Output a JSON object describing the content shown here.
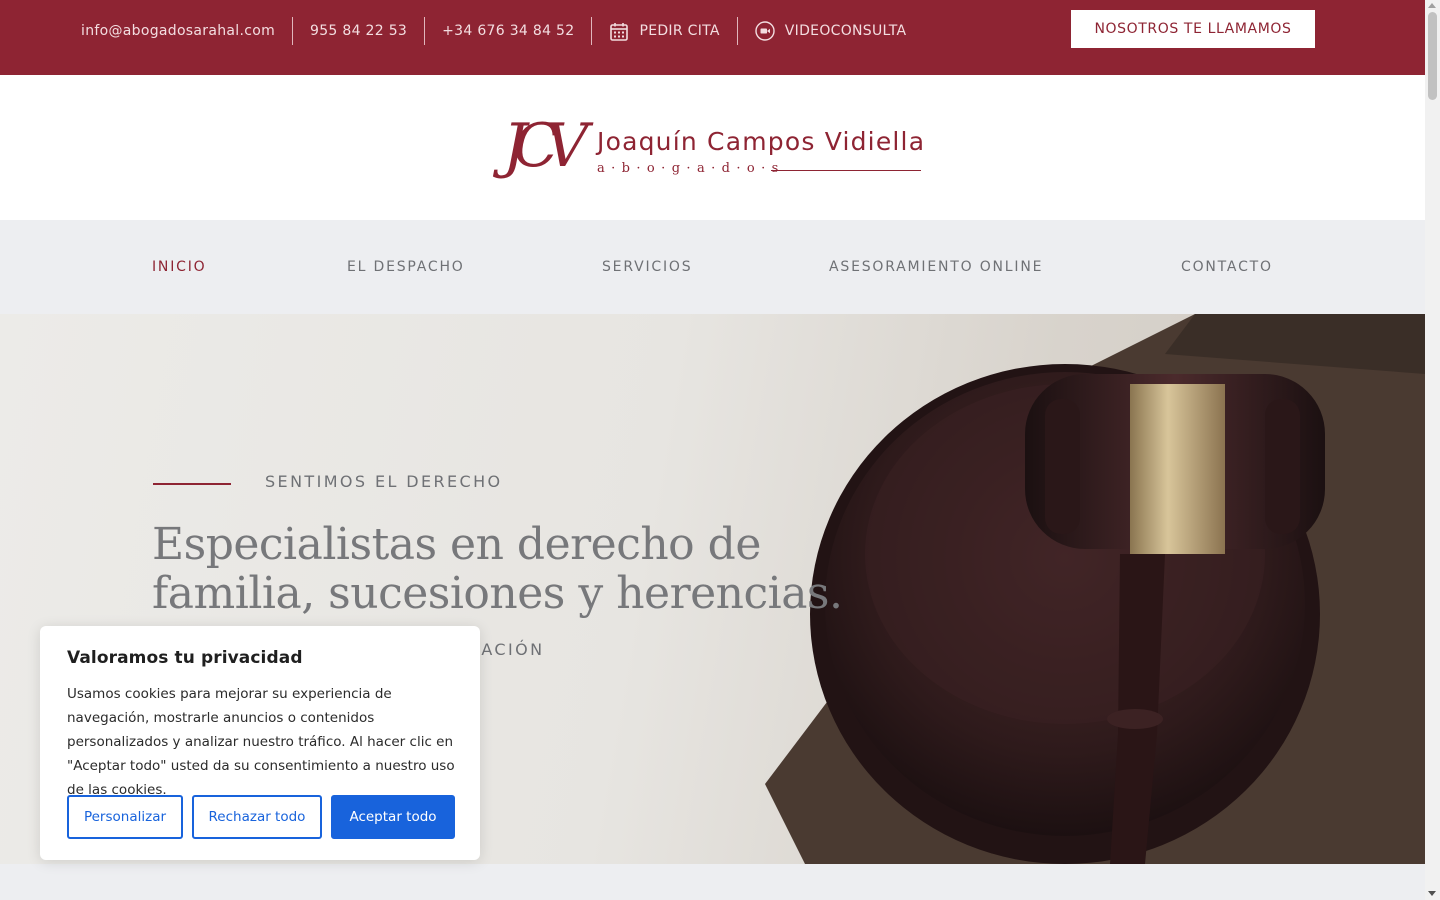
{
  "topbar": {
    "email": "info@abogadosarahal.com",
    "phone1": "955 84 22 53",
    "phone2": "+34 676 34 84 52",
    "appointment": "PEDIR CITA",
    "video": "VIDEOCONSULTA",
    "call_button": "NOSOTROS TE LLAMAMOS"
  },
  "logo": {
    "monogram": "JCV",
    "name": "Joaquín Campos Vidiella",
    "subtitle": "a·b·o·g·a·d·o·s"
  },
  "nav": {
    "items": [
      "INICIO",
      "EL DESPACHO",
      "SERVICIOS",
      "ASESORAMIENTO ONLINE",
      "CONTACTO"
    ],
    "active": "INICIO"
  },
  "hero": {
    "kicker": "SENTIMOS EL DERECHO",
    "headline": "Especialistas en derecho de familia, sucesiones y herencias.",
    "tagline_visible": "DICACIÓN"
  },
  "cookie": {
    "title": "Valoramos tu privacidad",
    "text": "Usamos cookies para mejorar su experiencia de navegación, mostrarle anuncios o contenidos personalizados y analizar nuestro tráfico. Al hacer clic en \"Aceptar todo\" usted da su consentimiento a nuestro uso de las cookies.",
    "customize": "Personalizar",
    "reject": "Rechazar todo",
    "accept": "Aceptar todo"
  },
  "colors": {
    "brand": "#8e2433",
    "nav_bg": "#edeef1",
    "cookie_primary": "#1863dc"
  },
  "icons": [
    "calendar-icon",
    "video-camera-icon"
  ]
}
